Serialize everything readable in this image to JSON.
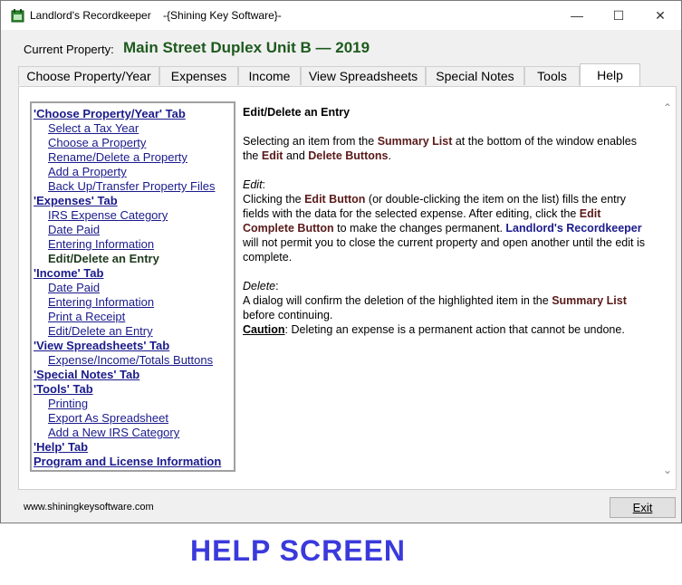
{
  "window": {
    "title": "Landlord's Recordkeeper    -{Shining Key Software}-",
    "minimize": "—",
    "maximize": "☐",
    "close": "✕"
  },
  "header": {
    "current_property_label": "Current Property:",
    "current_property_value": "Main Street Duplex Unit B — 2019"
  },
  "tabs": [
    {
      "label": "Choose Property/Year"
    },
    {
      "label": "Expenses"
    },
    {
      "label": "Income"
    },
    {
      "label": "View Spreadsheets"
    },
    {
      "label": "Special Notes"
    },
    {
      "label": "Tools"
    },
    {
      "label": "Help"
    }
  ],
  "toc": [
    {
      "label": "'Choose Property/Year' Tab",
      "level": 0
    },
    {
      "label": "Select a Tax Year",
      "level": 1
    },
    {
      "label": "Choose a Property",
      "level": 1
    },
    {
      "label": "Rename/Delete a Property",
      "level": 1
    },
    {
      "label": "Add a Property",
      "level": 1
    },
    {
      "label": "Back Up/Transfer Property Files",
      "level": 1
    },
    {
      "label": "'Expenses' Tab",
      "level": 0
    },
    {
      "label": "IRS Expense Category",
      "level": 1
    },
    {
      "label": "Date Paid",
      "level": 1
    },
    {
      "label": "Entering Information",
      "level": 1
    },
    {
      "label": "Edit/Delete an Entry",
      "level": 1,
      "current": true
    },
    {
      "label": "'Income' Tab",
      "level": 0
    },
    {
      "label": "Date Paid",
      "level": 1
    },
    {
      "label": "Entering Information",
      "level": 1
    },
    {
      "label": "Print a Receipt",
      "level": 1
    },
    {
      "label": "Edit/Delete an Entry",
      "level": 1
    },
    {
      "label": "'View Spreadsheets' Tab",
      "level": 0
    },
    {
      "label": "Expense/Income/Totals Buttons",
      "level": 1
    },
    {
      "label": "'Special Notes' Tab",
      "level": 0
    },
    {
      "label": "'Tools' Tab",
      "level": 0
    },
    {
      "label": "Printing",
      "level": 1
    },
    {
      "label": "Export As Spreadsheet",
      "level": 1
    },
    {
      "label": "Add a New IRS Category",
      "level": 1
    },
    {
      "label": "'Help' Tab",
      "level": 0
    },
    {
      "label": "Program and License Information",
      "level": 0
    }
  ],
  "content": {
    "heading": "Edit/Delete an Entry",
    "p1_a": "Selecting an item from the ",
    "p1_b": "Summary List",
    "p1_c": " at the bottom of the window enables the ",
    "p1_d": "Edit",
    "p1_e": " and ",
    "p1_f": "Delete Buttons",
    "p1_g": ".",
    "edit_title": "Edit",
    "edit_colon": ":",
    "p2_a": "Clicking the ",
    "p2_b": "Edit Button",
    "p2_c": " (or double-clicking the item on the list) fills the entry fields with the data for the selected expense. After editing, click the ",
    "p2_d": "Edit Complete Button",
    "p2_e": " to make the changes permanent. ",
    "p2_f": "Landlord's Recordkeeper",
    "p2_g": " will not permit you to close the current property and open another until the edit is complete.",
    "delete_title": "Delete",
    "delete_colon": ":",
    "p3_a": "A dialog will confirm the deletion of the highlighted item in the ",
    "p3_b": "Summary List",
    "p3_c": " before continuing.",
    "caution_title": "Caution",
    "caution_text": ": Deleting an expense is a permanent action that cannot be undone."
  },
  "footer": {
    "url": "www.shiningkeysoftware.com",
    "exit_label": "Exit"
  },
  "caption": "HELP SCREEN",
  "colors": {
    "property_green": "#1e5a1e",
    "link_blue": "#1a1a8c",
    "highlight_maroon": "#5a1a1a",
    "caption_blue": "#3a3adc"
  }
}
